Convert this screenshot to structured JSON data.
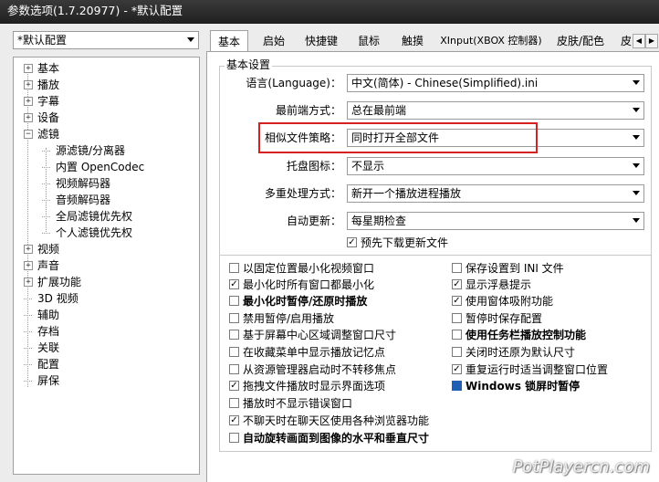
{
  "window": {
    "title": "参数选项(1.7.20977) - *默认配置"
  },
  "profile": {
    "selected": "*默认配置"
  },
  "tree": {
    "items": [
      {
        "label": "基本",
        "expandable": true
      },
      {
        "label": "播放",
        "expandable": true
      },
      {
        "label": "字幕",
        "expandable": true
      },
      {
        "label": "设备",
        "expandable": true
      },
      {
        "label": "滤镜",
        "expandable": true,
        "expanded": true
      },
      {
        "label": "源滤镜/分离器"
      },
      {
        "label": "内置 OpenCodec"
      },
      {
        "label": "视频解码器"
      },
      {
        "label": "音频解码器"
      },
      {
        "label": "全局滤镜优先权"
      },
      {
        "label": "个人滤镜优先权"
      },
      {
        "label": "视频",
        "expandable": true
      },
      {
        "label": "声音",
        "expandable": true
      },
      {
        "label": "扩展功能",
        "expandable": true
      },
      {
        "label": "3D 视频"
      },
      {
        "label": "辅助"
      },
      {
        "label": "存档"
      },
      {
        "label": "关联"
      },
      {
        "label": "配置"
      },
      {
        "label": "屏保"
      }
    ]
  },
  "tabs": [
    "基本",
    "启始",
    "快捷键",
    "鼠标",
    "触摸",
    "XInput(XBOX 控制器)",
    "皮肤/配色",
    "皮"
  ],
  "active_tab": "基本",
  "basic": {
    "group_title": "基本设置",
    "fields": [
      {
        "label": "语言(Language)：",
        "value": "中文(简体) - Chinese(Simplified).ini"
      },
      {
        "label": "最前端方式：",
        "value": "总在最前端"
      },
      {
        "label": "相似文件策略：",
        "value": "同时打开全部文件"
      },
      {
        "label": "托盘图标：",
        "value": "不显示"
      },
      {
        "label": "多重处理方式：",
        "value": "新开一个播放进程播放"
      },
      {
        "label": "自动更新：",
        "value": "每星期检查"
      }
    ],
    "predownload": {
      "label": "预先下载更新文件",
      "checked": true
    }
  },
  "options_left": [
    {
      "label": "以固定位置最小化视频窗口",
      "checked": false
    },
    {
      "label": "最小化时所有窗口都最小化",
      "checked": true
    },
    {
      "label": "最小化时暂停/还原时播放",
      "checked": false,
      "bold": true
    },
    {
      "label": "禁用暂停/启用播放",
      "checked": false
    },
    {
      "label": "基于屏幕中心区域调整窗口尺寸",
      "checked": false
    },
    {
      "label": "在收藏菜单中显示播放记忆点",
      "checked": false
    },
    {
      "label": "从资源管理器启动时不转移焦点",
      "checked": false
    },
    {
      "label": "拖拽文件播放时显示界面选项",
      "checked": true
    },
    {
      "label": "播放时不显示错误窗口",
      "checked": false
    },
    {
      "label": "不聊天时在聊天区使用各种浏览器功能",
      "checked": true
    },
    {
      "label": "自动旋转画面到图像的水平和垂直尺寸",
      "checked": false,
      "bold": true
    }
  ],
  "options_right": [
    {
      "label": "保存设置到 INI 文件",
      "checked": false
    },
    {
      "label": "显示浮悬提示",
      "checked": true
    },
    {
      "label": "使用窗体吸附功能",
      "checked": true
    },
    {
      "label": "暂停时保存配置",
      "checked": false
    },
    {
      "label": "使用任务栏播放控制功能",
      "checked": false,
      "bold": true
    },
    {
      "label": "关闭时还原为默认尺寸",
      "checked": false
    },
    {
      "label": "重复运行时适当调整窗口位置",
      "checked": true
    },
    {
      "label": "Windows 锁屏时暂停",
      "checked": false,
      "bold": true,
      "filled": true
    }
  ],
  "watermark": "PotPlayercn.com"
}
